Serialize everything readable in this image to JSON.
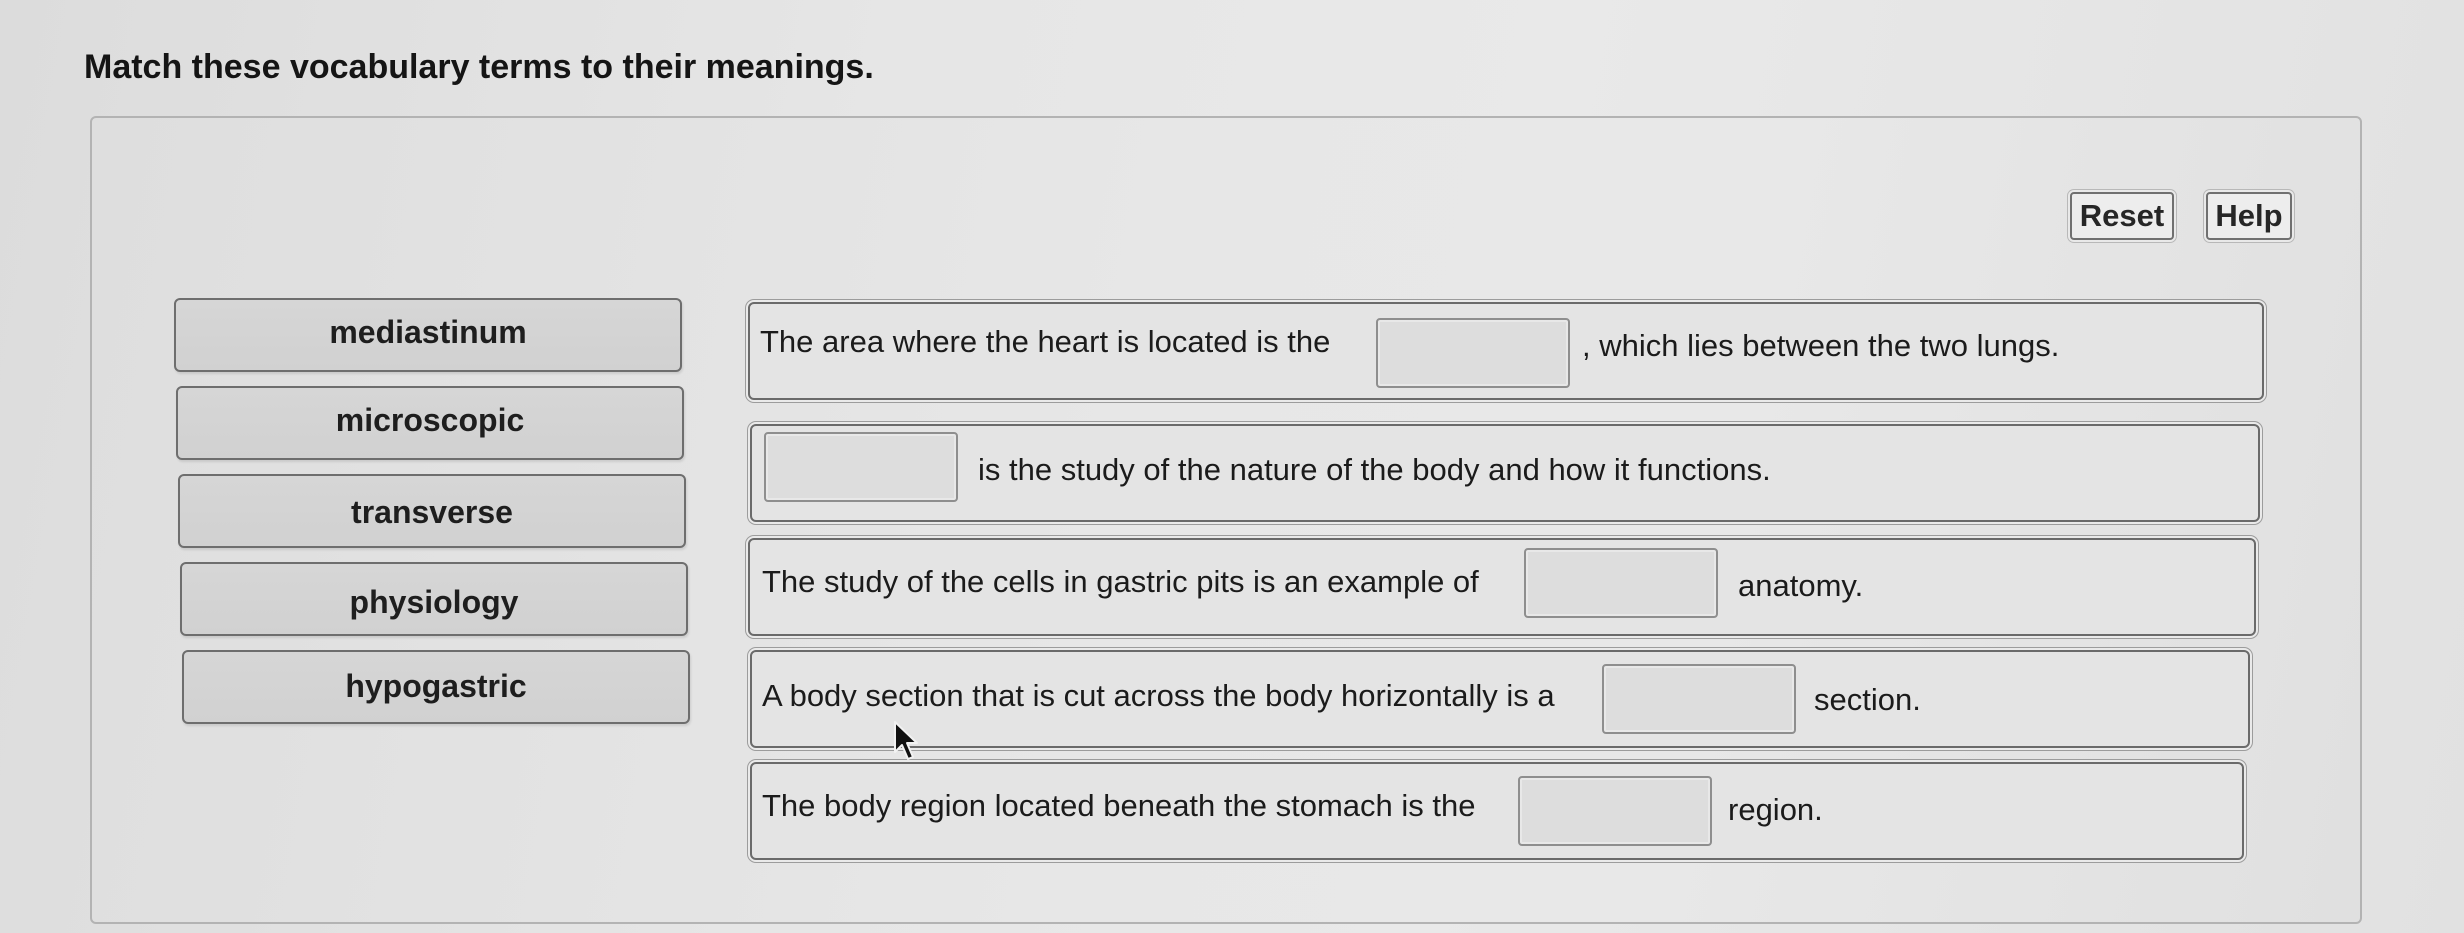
{
  "instructions": "Match these vocabulary terms to their meanings.",
  "buttons": {
    "reset": "Reset",
    "help": "Help"
  },
  "terms": [
    "mediastinum",
    "microscopic",
    "transverse",
    "physiology",
    "hypogastric"
  ],
  "sentences": [
    {
      "before": "The area where the heart is located is the",
      "after": ", which lies between the two lungs."
    },
    {
      "before": "",
      "after": "is the study of the nature of the body and how it functions."
    },
    {
      "before": "The study of the cells in gastric pits is an example of",
      "after": "anatomy."
    },
    {
      "before": "A body section that is cut across the body horizontally is a",
      "after": "section."
    },
    {
      "before": "The body region located beneath the stomach is the",
      "after": "region."
    }
  ],
  "icons": {
    "cursor": "mouse-pointer-icon"
  }
}
